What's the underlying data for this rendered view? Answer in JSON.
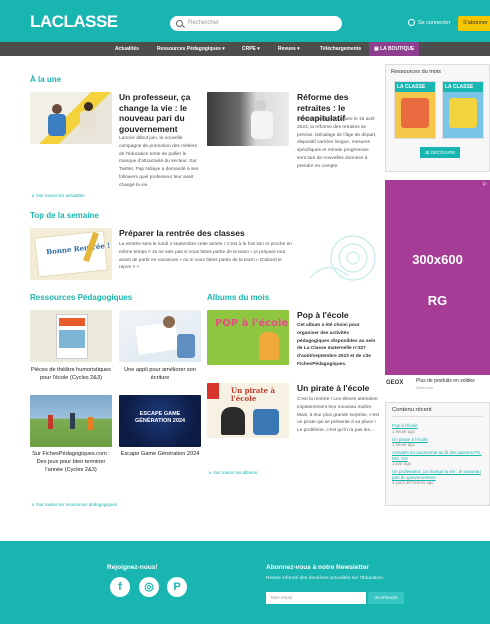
{
  "header": {
    "logo": "LACLASSE",
    "search_placeholder": "Rechercher",
    "login": "Se connecter",
    "subscribe": "S'abonner"
  },
  "nav": [
    "Actualités",
    "Ressources Pédagogiques ▾",
    "CRPE ▾",
    "Revues ▾",
    "Téléchargements",
    "LA BOUTIQUE"
  ],
  "a_la_une": {
    "heading": "À la une",
    "articles": [
      {
        "title": "Un professeur, ça change la vie : le nouveau pari du gouvernement",
        "text": "Lancée début juin, la nouvelle campagne de promotion des métiers de l'éducation tente de pallier le manque d'attractivité du secteur. Sur Twitter, Pap Ndiaye a demandé à ses followers quel professeur leur avait changé la vie."
      },
      {
        "title": "Réforme des retraites : le récapitulatif",
        "text": "Officiellement promulguée le 15 avril 2023, la réforme des retraites se précise. Décalage de l'âge de départ, dispositif carrière longue, mesures spécifiques et retraite progressive sont tant de nouvelles données à prendre en compte."
      }
    ],
    "see_all": "↳ Voir toutes les actualités"
  },
  "top_semaine": {
    "heading": "Top de la semaine",
    "title": "Préparer la rentrée des classes",
    "text": "La rentrée sera le lundi 4 septembre cette année ! C'est à la fois loin et proche en même temps !! Je ne sais pas si vous faites partie de la team « je prépare tout avant de partir en vacances » ou si vous faites partie de la team « D'abord le repos !! »",
    "img_label": "Bonne Rentrée !"
  },
  "ressources": {
    "heading": "Ressources Pédagogiques",
    "items": [
      {
        "label": "Pièces de théâtre humoristiques pour l'école (Cycles 2&3)"
      },
      {
        "label": "Une appli pour améliorer son écriture"
      },
      {
        "label": "Sur FichesPédagogiques.com : Des jeux pour bien terminer l'année (Cycles 2&3)"
      },
      {
        "label": "Escape Game Génération 2024"
      }
    ],
    "see_all": "↳ Voir toutes les ressources pédagogiques",
    "escape_img_text": "ESCAPE GAME GÉNÉRATION 2024"
  },
  "albums": {
    "heading": "Albums du mois",
    "items": [
      {
        "title": "Pop à l'école",
        "text": "Cet album a été choisi pour organiser des activités pédagogiques disponibles au sein de La Classe maternelle n°327 d'août/septembre 2023 et de cite FichesPédagogiques.",
        "cover": "POP à l'école"
      },
      {
        "title": "Un pirate à l'école",
        "text": "C'est la rentrée ! Les élèves attendent impatiemment leur nouveau maître. Mais, à leur plus grande surprise, c'est un pirate qui se présente à sa place ! Le problème, c'est qu'il n'a pas les...",
        "cover": "Un pirate à l'école"
      }
    ],
    "see_all": "↳ Voir toutes les albums"
  },
  "sidebar": {
    "ressources_mois": "Ressources du mois",
    "mag1": "LA CLASSE",
    "mag2": "LA CLASSE",
    "discover": "JE DÉCOUVRE",
    "ad_size": "300x600",
    "ad_rg": "RG",
    "ad_corner": "▷",
    "geox_brand": "GEOX",
    "geox_text": "Plus de produits en soldes",
    "geox_domain": "Geox.com",
    "recent_heading": "Contenu récent",
    "recent": [
      {
        "title": "Pop à l'école",
        "time": "1 heure ago"
      },
      {
        "title": "Un pirate à l'école",
        "time": "1 heure ago"
      },
      {
        "title": "Activités en autonomie au fil des saisons PS, MS, GS",
        "time": "1 jour ago"
      },
      {
        "title": "Un professeur, ça change la vie : le nouveau pari du gouvernement",
        "time": "4 jours 20 heures ago"
      }
    ]
  },
  "footer": {
    "social_heading": "Rejoignez-nous!",
    "newsletter_heading": "Abonnez-vous à notre Newsletter",
    "newsletter_text": "Restez informé des dernières actualités sur l'Éducation.",
    "email_placeholder": "Mon email",
    "submit": "Je m'inscris",
    "facebook": "f",
    "instagram": "◎",
    "pinterest": "P"
  },
  "colors": {
    "accent": "#19b5b0",
    "nav": "#4d4d4d",
    "boutique": "#8e3e8f",
    "ad": "#a63c95"
  }
}
